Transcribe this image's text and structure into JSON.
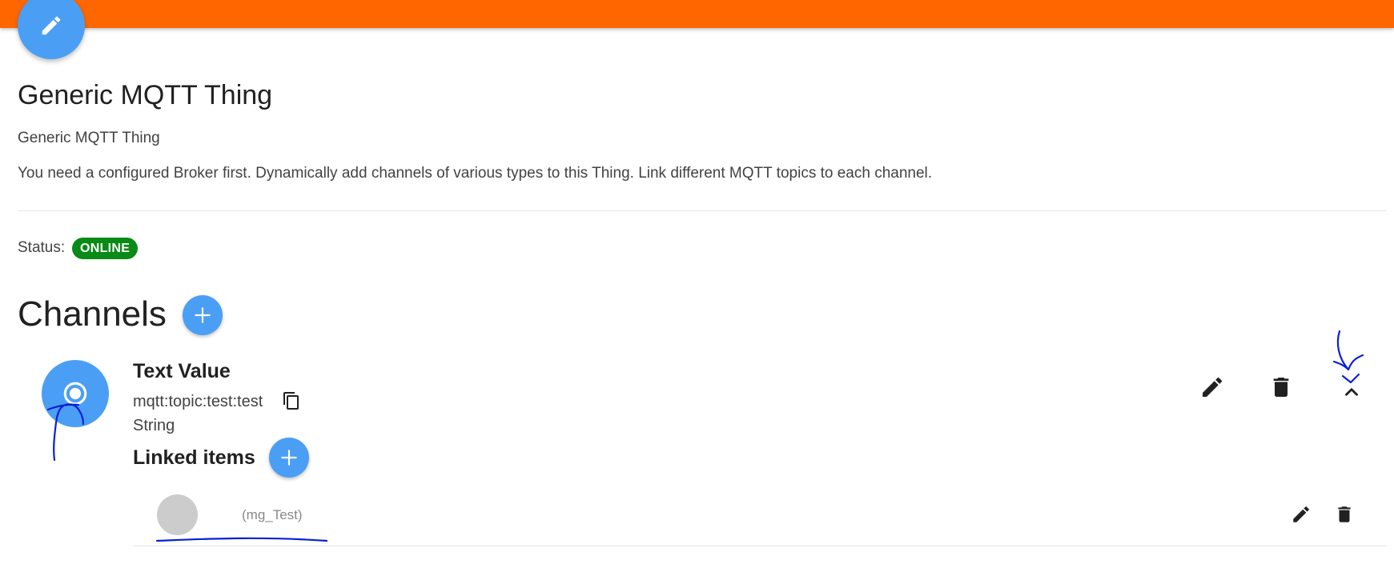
{
  "header": {
    "edit_fab_icon": "pencil-icon",
    "accent_color": "#ff6600",
    "fab_color": "#4a9ff5"
  },
  "thing": {
    "title": "Generic MQTT Thing",
    "subtitle": "Generic MQTT Thing",
    "description": "You need a configured Broker first. Dynamically add channels of various types to this Thing. Link different MQTT topics to each channel.",
    "status_label": "Status:",
    "status_value": "ONLINE",
    "status_color": "#0a8a16"
  },
  "channels": {
    "heading": "Channels",
    "add_icon": "plus-icon",
    "items": [
      {
        "name": "Text Value",
        "uid": "mqtt:topic:test:test",
        "type": "String",
        "icon": "radio-button-icon",
        "linked_heading": "Linked items",
        "linked_items": [
          {
            "label": "(mg_Test)"
          }
        ]
      }
    ]
  }
}
